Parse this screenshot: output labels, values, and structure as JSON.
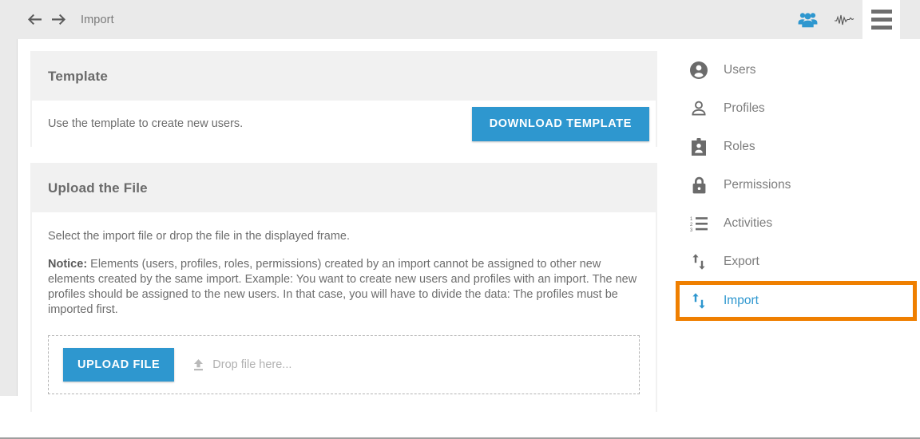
{
  "header": {
    "back_icon": "arrow-left-icon",
    "forward_icon": "arrow-right-icon",
    "breadcrumb": "Import",
    "icons": [
      {
        "name": "users-group-icon",
        "color": "#2e97cf"
      },
      {
        "name": "activity-pulse-icon",
        "color": "#555555"
      },
      {
        "name": "hamburger-menu-icon",
        "color": "#6e6e6e"
      }
    ]
  },
  "template_card": {
    "title": "Template",
    "description": "Use the template to create new users.",
    "download_button": "DOWNLOAD TEMPLATE"
  },
  "upload_card": {
    "title": "Upload the File",
    "lead": "Select the import file or drop the file in the displayed frame.",
    "notice_label": "Notice:",
    "notice_text": " Elements (users, profiles, roles, permissions) created by an import cannot be assigned to other new elements created by the same import. Example: You want to create new users and profiles with an import. The new profiles should be assigned to the new users. In that case, you will have to divide the data: The profiles must be imported first.",
    "upload_button": "UPLOAD FILE",
    "drop_hint": "Drop file here...",
    "drop_icon": "upload-arrow-icon"
  },
  "sidemenu": {
    "active_color": "#2e97cf",
    "highlight_color": "#ef7f00",
    "items": [
      {
        "label": "Users",
        "icon": "user-circle-icon",
        "active": false
      },
      {
        "label": "Profiles",
        "icon": "person-icon",
        "active": false
      },
      {
        "label": "Roles",
        "icon": "id-badge-icon",
        "active": false
      },
      {
        "label": "Permissions",
        "icon": "lock-icon",
        "active": false
      },
      {
        "label": "Activities",
        "icon": "numbered-list-icon",
        "active": false
      },
      {
        "label": "Export",
        "icon": "arrows-up-down-icon",
        "active": false
      },
      {
        "label": "Import",
        "icon": "arrows-up-down-icon",
        "active": true
      }
    ]
  }
}
